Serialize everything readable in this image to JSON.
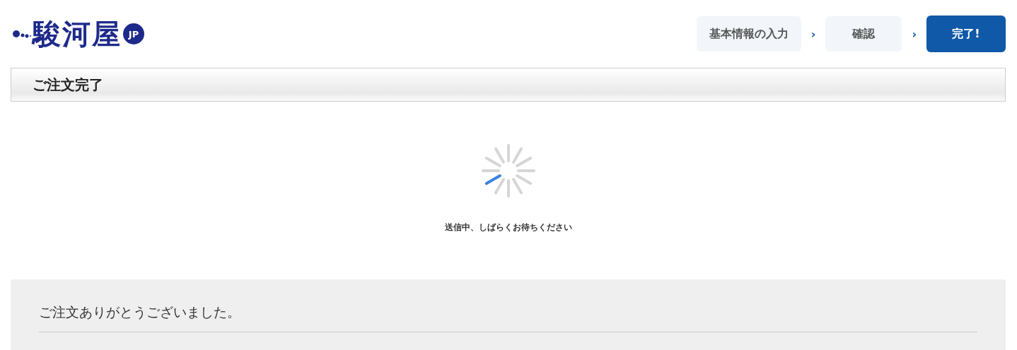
{
  "logo": {
    "text": "駿河屋",
    "badge": "JP"
  },
  "steps": [
    {
      "label": "基本情報の入力",
      "selected": false,
      "separator": "›"
    },
    {
      "label": "確認",
      "selected": false,
      "separator": "›"
    },
    {
      "label": "完了!",
      "selected": true
    }
  ],
  "page_title": "ご注文完了",
  "loading": {
    "message": "送信中、しばらくお待ちください"
  },
  "thanks_panel": {
    "heading": "ご注文ありがとうございました。"
  }
}
